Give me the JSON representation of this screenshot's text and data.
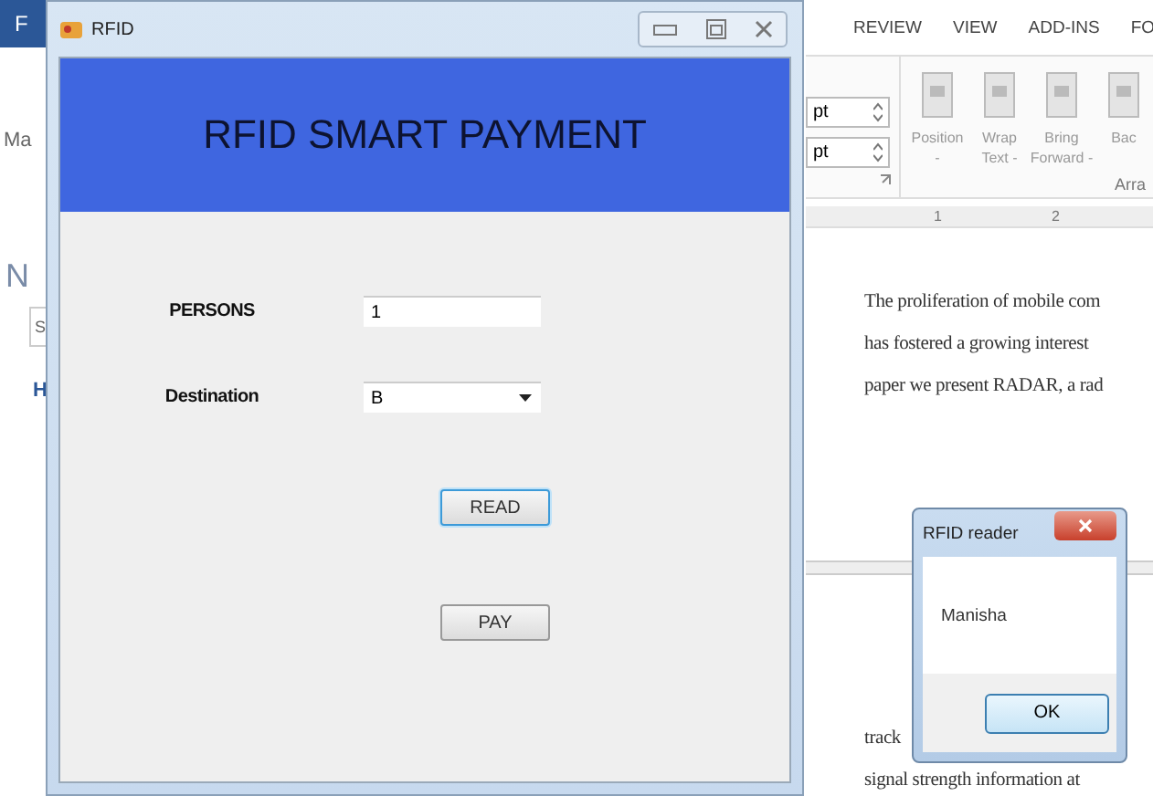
{
  "word": {
    "file_tab": "F",
    "left_fragments": [
      {
        "kind": "label",
        "text": "Ma"
      },
      {
        "kind": "heading",
        "text": "N"
      },
      {
        "kind": "search",
        "text": "S"
      },
      {
        "kind": "link",
        "text": "H"
      }
    ],
    "tabs": [
      "REVIEW",
      "VIEW",
      "ADD-INS",
      "FO"
    ],
    "spinners": [
      {
        "value": "pt"
      },
      {
        "value": "pt"
      }
    ],
    "ribbon_buttons": [
      {
        "label": "Position",
        "sub": "-"
      },
      {
        "label": "Wrap",
        "sub": "Text -"
      },
      {
        "label": "Bring",
        "sub": "Forward -"
      },
      {
        "sub": "Bac"
      }
    ],
    "group_label": "Arra",
    "ruler": [
      "1",
      "2"
    ],
    "paragraph_lines": [
      "The proliferation of mobile com",
      "has fostered a growing interest",
      "paper we present RADAR, a rad"
    ],
    "bottom_lines": [
      "track",
      "signal strength information at"
    ]
  },
  "form": {
    "title": "RFID",
    "header": "RFID SMART PAYMENT",
    "fields": [
      {
        "kind": "text",
        "label": "PERSONS",
        "value": "1"
      },
      {
        "kind": "dropdown",
        "label": "Destination",
        "value": "B"
      }
    ],
    "buttons": [
      {
        "label": "READ",
        "focused": true
      },
      {
        "label": "PAY",
        "focused": false
      }
    ]
  },
  "dialog": {
    "title": "RFID reader",
    "message": "Manisha",
    "button": "OK"
  }
}
